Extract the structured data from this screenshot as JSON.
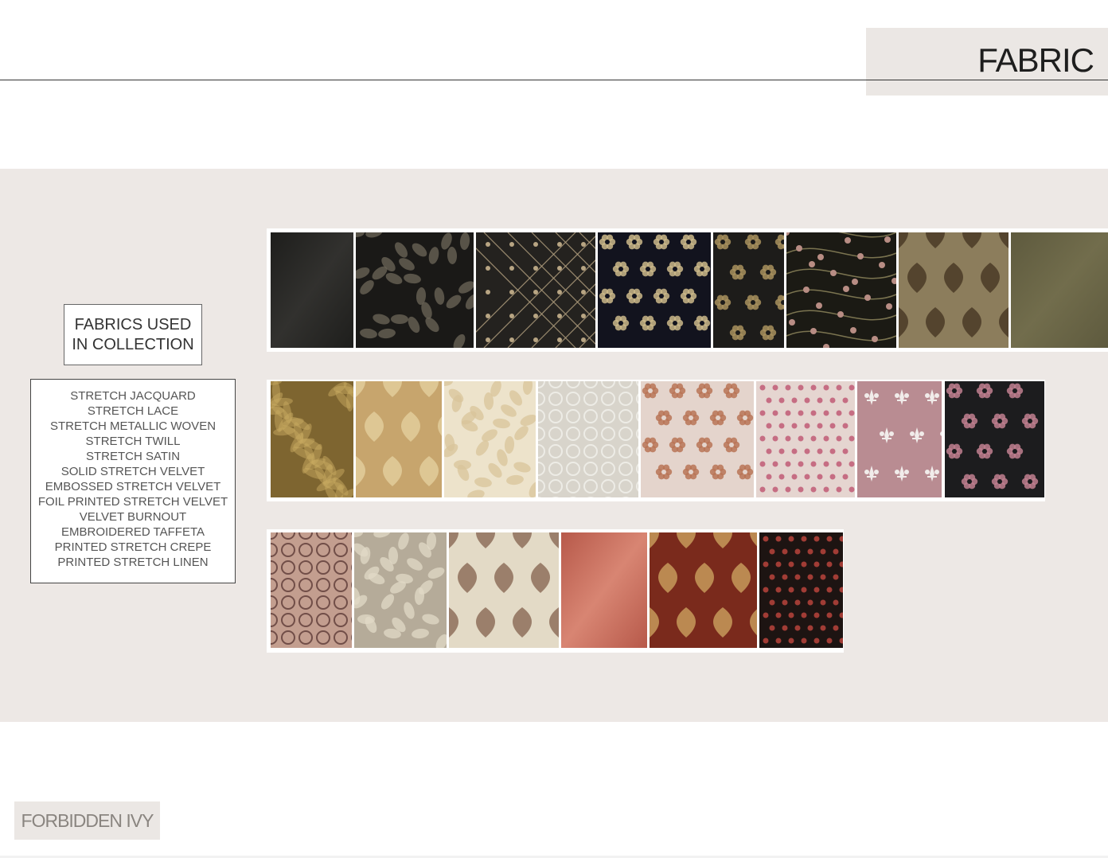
{
  "header": {
    "title": "FABRIC"
  },
  "sidebar": {
    "heading": "FABRICS USED IN COLLECTION",
    "fabrics": [
      "STRETCH JACQUARD",
      "STRETCH LACE",
      "STRETCH METALLIC WOVEN",
      "STRETCH TWILL",
      "STRETCH SATIN",
      "SOLID STRETCH VELVET",
      "EMBOSSED STRETCH VELVET",
      "FOIL PRINTED STRETCH VELVET",
      "VELVET BURNOUT",
      "EMBROIDERED TAFFETA",
      "PRINTED STRETCH CREPE",
      "PRINTED STRETCH LINEN"
    ]
  },
  "footer": {
    "brand": "FORBIDDEN IVY"
  },
  "colors": {
    "band": "#ede8e5",
    "title_box": "#ebe7e4",
    "text": "#2a2a2a"
  },
  "swatch_rows": [
    [
      {
        "name": "black-satin",
        "base": "#1e1e1c",
        "motif": "#3a3936",
        "pattern": "sheen"
      },
      {
        "name": "black-floral-jacquard",
        "base": "#1a1917",
        "motif": "#6e675a",
        "pattern": "leaves"
      },
      {
        "name": "black-gold-trellis",
        "base": "#24221f",
        "motif": "#b8a583",
        "pattern": "trellis"
      },
      {
        "name": "navy-gold-floral",
        "base": "#12131e",
        "motif": "#cbb88a",
        "pattern": "flowers"
      },
      {
        "name": "black-gold-rose",
        "base": "#1d1c1a",
        "motif": "#a8915e",
        "pattern": "roses"
      },
      {
        "name": "black-pink-vine",
        "base": "#1b1a14",
        "motif": "#b88d84",
        "pattern": "vine"
      },
      {
        "name": "olive-damask",
        "base": "#8c7d5c",
        "motif": "#4a3a26",
        "pattern": "damask"
      },
      {
        "name": "olive-metallic",
        "base": "#5e5a3e",
        "motif": "#7a7552",
        "pattern": "sheen"
      }
    ],
    [
      {
        "name": "gold-crushed-velvet",
        "base": "#7e6530",
        "motif": "#c7a960",
        "pattern": "crush"
      },
      {
        "name": "gold-damask",
        "base": "#c7a56d",
        "motif": "#e2cd9b",
        "pattern": "damask"
      },
      {
        "name": "cream-floral-burnout",
        "base": "#ede3cb",
        "motif": "#d8c49a",
        "pattern": "leaves"
      },
      {
        "name": "ivory-lace",
        "base": "#d8d4cb",
        "motif": "#f3f1ec",
        "pattern": "lace"
      },
      {
        "name": "blush-embroidered",
        "base": "#e4d4cc",
        "motif": "#b87456",
        "pattern": "flowers"
      },
      {
        "name": "pink-rose-print",
        "base": "#e5d5d0",
        "motif": "#c2627a",
        "pattern": "dots"
      },
      {
        "name": "mauve-fleur",
        "base": "#b98c92",
        "motif": "#f1ecea",
        "pattern": "fleur"
      },
      {
        "name": "black-pink-paisley",
        "base": "#1c1c1e",
        "motif": "#c07f8f",
        "pattern": "roses"
      }
    ],
    [
      {
        "name": "brown-lace-print",
        "base": "#c39e8f",
        "motif": "#5c3a36",
        "pattern": "lace"
      },
      {
        "name": "silver-floral-jacquard",
        "base": "#b5ab99",
        "motif": "#e1d9c7",
        "pattern": "leaves"
      },
      {
        "name": "cream-tapestry",
        "base": "#e3dac6",
        "motif": "#8e6f5a",
        "pattern": "damask"
      },
      {
        "name": "coral-velvet",
        "base": "#b7594a",
        "motif": "#e69884",
        "pattern": "sheen"
      },
      {
        "name": "rust-gold-damask",
        "base": "#7a2a1c",
        "motif": "#c79a5a",
        "pattern": "damask"
      },
      {
        "name": "black-red-floral",
        "base": "#1d1412",
        "motif": "#b0403a",
        "pattern": "dots"
      }
    ]
  ]
}
